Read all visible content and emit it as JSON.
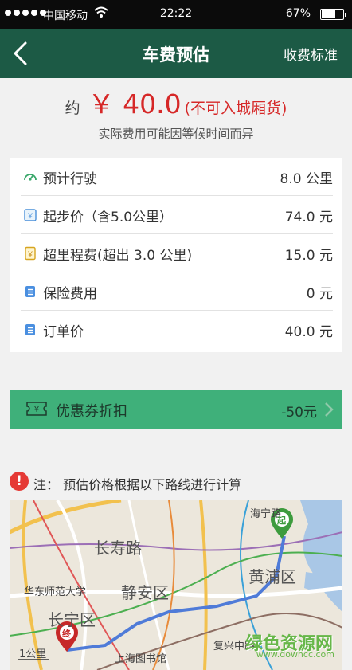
{
  "status_bar": {
    "carrier": "中国移动",
    "time": "22:22",
    "battery_pct": "67%",
    "battery_level": 0.67,
    "signal_bars": 5
  },
  "nav": {
    "title": "车费预估",
    "right_action": "收费标准",
    "back_icon": "chevron-left-icon"
  },
  "price": {
    "approx": "约",
    "amount": "￥ 40.0",
    "note": "(不可入城厢货)"
  },
  "subnote": "实际费用可能因等候时间而异",
  "fees": [
    {
      "icon": "speedometer-icon",
      "label": "预计行驶",
      "value": "8.0  公里"
    },
    {
      "icon": "receipt-icon",
      "label": "起步价（含5.0公里）",
      "value": "74.0  元"
    },
    {
      "icon": "tag-icon",
      "label": "超里程费(超出 3.0 公里)",
      "value": "15.0  元"
    },
    {
      "icon": "document-icon",
      "label": "保险费用",
      "value": "0  元"
    },
    {
      "icon": "document-icon",
      "label": "订单价",
      "value": "40.0  元"
    }
  ],
  "coupon": {
    "icon": "coupon-icon",
    "label": "优惠券折扣",
    "value": "-50元"
  },
  "route_note": {
    "icon": "warning-icon",
    "mark": "!",
    "text": "注：  预估价格根据以下路线进行计算"
  },
  "map": {
    "labels": {
      "haining": "海宁路",
      "changshou": "长寿路",
      "huangpu": "黄浦区",
      "huashi": "华东师范大学",
      "jingan": "静安区",
      "changning": "长宁区",
      "fuxing": "复兴中路",
      "library": "上海图书馆",
      "scale": "1公里"
    },
    "start_marker": "起",
    "end_marker": "终",
    "colors": {
      "route": "#4f7bd8",
      "start": "#3d9b3d",
      "end": "#c62828"
    }
  },
  "watermark": {
    "title": "绿色资源网",
    "url": "www.downcc.com"
  }
}
